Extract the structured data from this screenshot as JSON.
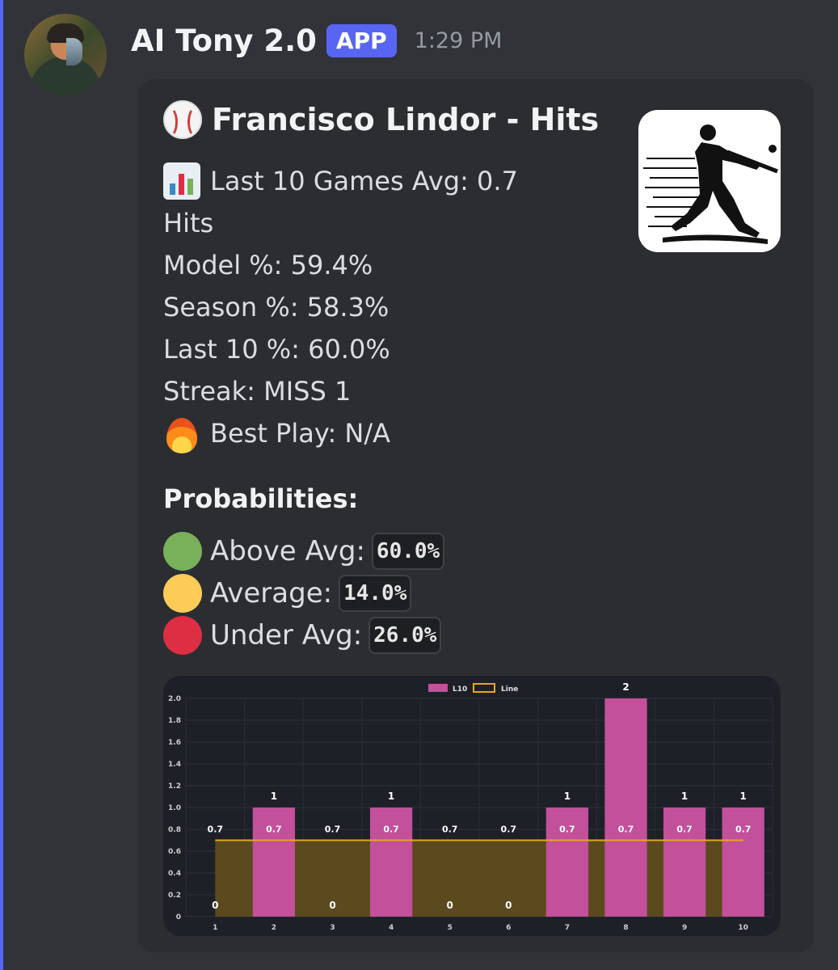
{
  "message": {
    "username": "AI Tony 2.0",
    "badge": "APP",
    "timestamp": "1:29 PM"
  },
  "embed": {
    "title": "Francisco Lindor - Hits",
    "title_icon": "baseball-icon",
    "thumbnail_icon": "batter-silhouette-icon",
    "lines": {
      "last10_a": "Last 10 Games Avg: 0.7",
      "last10_b": "Hits",
      "model": "Model %: 59.4%",
      "season": "Season %: 58.3%",
      "last10pct": "Last 10 %: 60.0%",
      "streak": "Streak: MISS 1",
      "best_play": "Best Play: N/A"
    },
    "probabilities_title": "Probabilities:",
    "probabilities": [
      {
        "label": "Above Avg:",
        "value": "60.0%",
        "color": "#78b159"
      },
      {
        "label": "Average:",
        "value": "14.0%",
        "color": "#fdcb58"
      },
      {
        "label": "Under Avg:",
        "value": "26.0%",
        "color": "#dd2e44"
      }
    ]
  },
  "colors": {
    "accent": "#5865f2",
    "bar": "#c2509b",
    "line": "#e6a817",
    "line_fill": "#5a4a1e"
  },
  "chart_data": {
    "type": "bar",
    "categories": [
      "1",
      "2",
      "3",
      "4",
      "5",
      "6",
      "7",
      "8",
      "9",
      "10"
    ],
    "series": [
      {
        "name": "L10",
        "values": [
          0,
          1,
          0,
          1,
          0,
          0,
          1,
          2,
          1,
          1
        ]
      },
      {
        "name": "Line",
        "values": [
          0.7,
          0.7,
          0.7,
          0.7,
          0.7,
          0.7,
          0.7,
          0.7,
          0.7,
          0.7
        ]
      }
    ],
    "bar_labels": [
      "0",
      "1",
      "0",
      "1",
      "0",
      "0",
      "1",
      "2",
      "1",
      "1"
    ],
    "line_labels": [
      "0.7",
      "0.7",
      "0.7",
      "0.7",
      "0.7",
      "0.7",
      "0.7",
      "0.7",
      "0.7",
      "0.7"
    ],
    "y_ticks": [
      "0",
      "0.2",
      "0.4",
      "0.6",
      "0.8",
      "1.0",
      "1.2",
      "1.4",
      "1.6",
      "1.8",
      "2.0"
    ],
    "ylim": [
      0,
      2.0
    ],
    "legend": [
      "L10",
      "Line"
    ],
    "legend_position": "top",
    "grid": true
  }
}
